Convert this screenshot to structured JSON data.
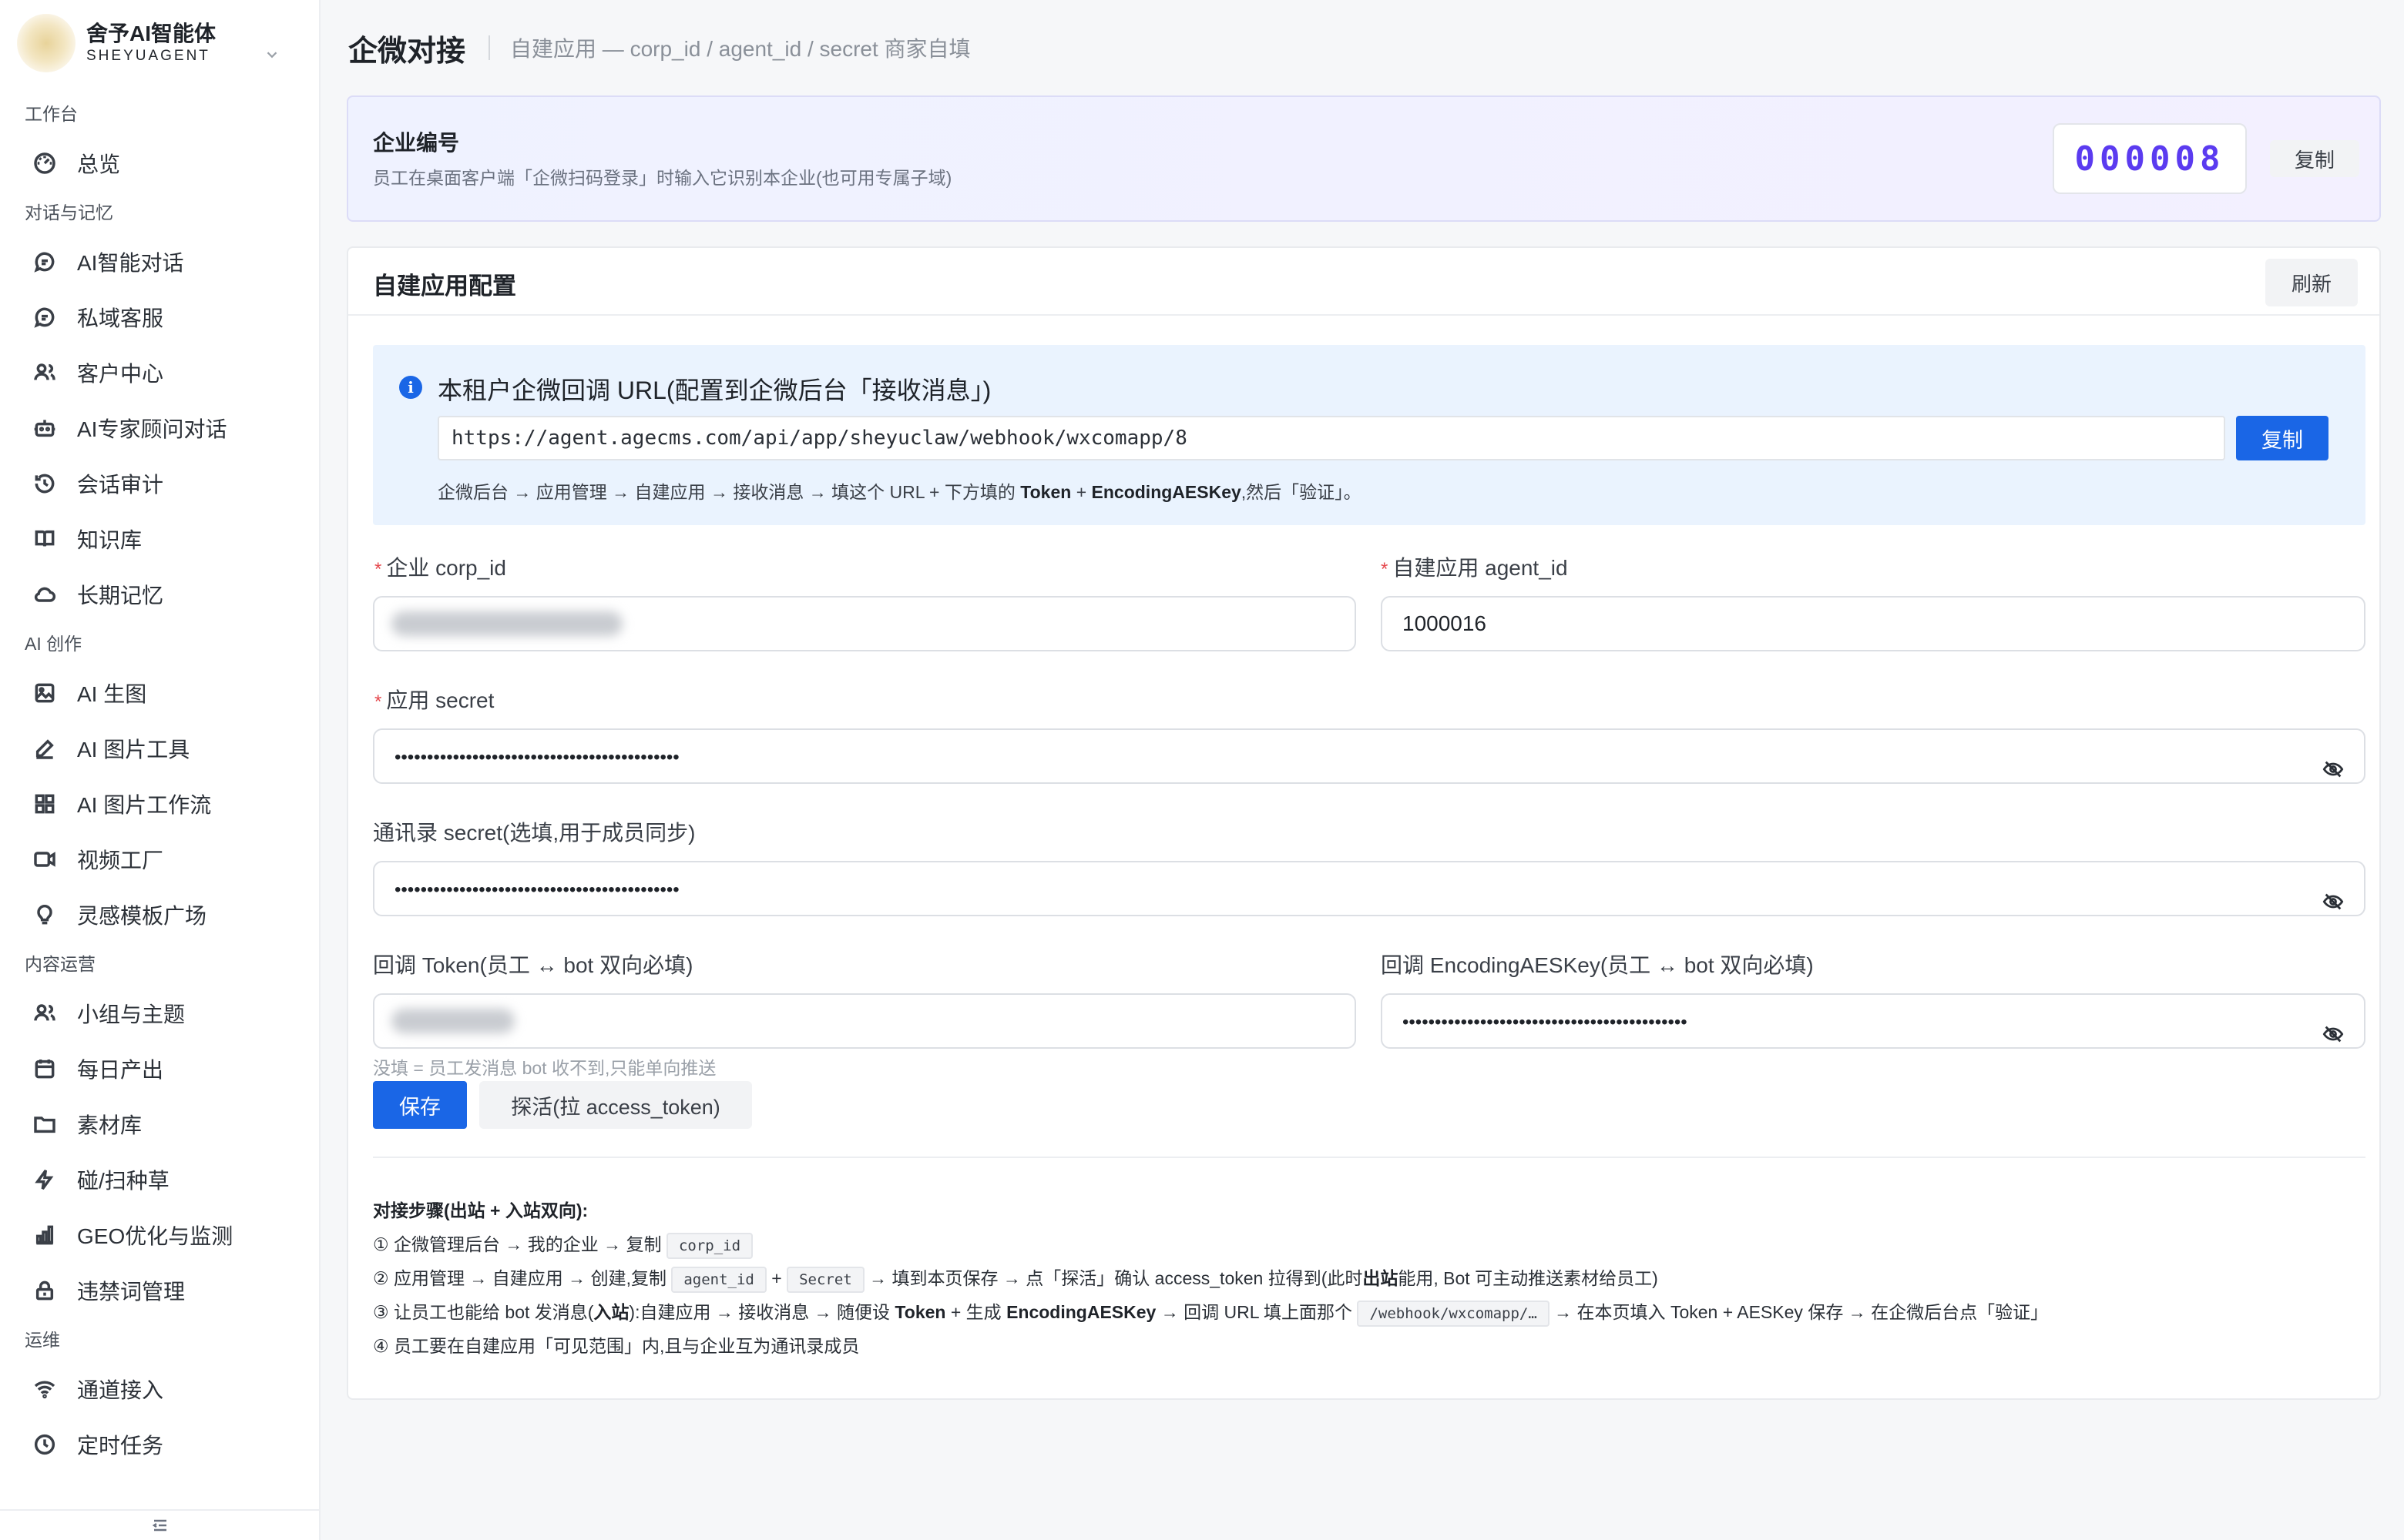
{
  "brand": {
    "name": "舍予AI智能体",
    "sub": "SHEYUAGENT"
  },
  "nav": {
    "sections": [
      {
        "title": "工作台",
        "items": [
          {
            "label": "总览",
            "icon": "dashboard-icon"
          }
        ]
      },
      {
        "title": "对话与记忆",
        "items": [
          {
            "label": "AI智能对话",
            "icon": "chat-icon"
          },
          {
            "label": "私域客服",
            "icon": "chat-icon"
          },
          {
            "label": "客户中心",
            "icon": "users-icon"
          },
          {
            "label": "AI专家顾问对话",
            "icon": "robot-icon"
          },
          {
            "label": "会话审计",
            "icon": "history-icon"
          },
          {
            "label": "知识库",
            "icon": "book-icon"
          },
          {
            "label": "长期记忆",
            "icon": "cloud-icon"
          }
        ]
      },
      {
        "title": "AI 创作",
        "items": [
          {
            "label": "AI 生图",
            "icon": "image-icon"
          },
          {
            "label": "AI 图片工具",
            "icon": "edit-icon"
          },
          {
            "label": "AI 图片工作流",
            "icon": "grid-icon"
          },
          {
            "label": "视频工厂",
            "icon": "video-icon"
          },
          {
            "label": "灵感模板广场",
            "icon": "bulb-icon"
          }
        ]
      },
      {
        "title": "内容运营",
        "items": [
          {
            "label": "小组与主题",
            "icon": "users-icon"
          },
          {
            "label": "每日产出",
            "icon": "calendar-icon"
          },
          {
            "label": "素材库",
            "icon": "folder-icon"
          },
          {
            "label": "碰/扫种草",
            "icon": "bolt-icon"
          },
          {
            "label": "GEO优化与监测",
            "icon": "bar-chart-icon"
          },
          {
            "label": "违禁词管理",
            "icon": "lock-icon"
          }
        ]
      },
      {
        "title": "运维",
        "items": [
          {
            "label": "通道接入",
            "icon": "wifi-icon"
          },
          {
            "label": "定时任务",
            "icon": "clock-icon"
          }
        ]
      }
    ]
  },
  "header": {
    "title": "企微对接",
    "breadcrumb": "自建应用 — corp_id / agent_id / secret 商家自填"
  },
  "company": {
    "title": "企业编号",
    "desc": "员工在桌面客户端「企微扫码登录」时输入它识别本企业(也可用专属子域)",
    "code": "000008",
    "copy_label": "复制"
  },
  "config": {
    "title": "自建应用配置",
    "refresh_label": "刷新",
    "callback": {
      "title": "本租户企微回调 URL(配置到企微后台「接收消息」)",
      "url": "https://agent.agecms.com/api/app/sheyuclaw/webhook/wxcomapp/8",
      "copy_label": "复制",
      "hint_pre": "企微后台 → 应用管理 → 自建应用 → 接收消息 → 填这个 URL + 下方填的 ",
      "hint_token": "Token",
      "hint_plus": " + ",
      "hint_aes": "EncodingAESKey",
      "hint_post": ",然后「验证」。"
    },
    "fields": {
      "corp_id_label": "企业 corp_id",
      "agent_id_label": "自建应用 agent_id",
      "agent_id_value": "1000016",
      "secret_label": "应用 secret",
      "secret_value": "••••••••••••••••••••••••••••••••••••••••••••",
      "contacts_secret_label": "通讯录 secret(选填,用于成员同步)",
      "contacts_secret_value": "••••••••••••••••••••••••••••••••••••••••••••",
      "token_label": "回调 Token(员工 ↔ bot 双向必填)",
      "aes_label": "回调 EncodingAESKey(员工 ↔ bot 双向必填)",
      "aes_value": "••••••••••••••••••••••••••••••••••••••••••••",
      "token_hint": "没填 = 员工发消息 bot 收不到,只能单向推送"
    },
    "actions": {
      "save_label": "保存",
      "probe_label": "探活(拉 access_token)"
    },
    "steps": {
      "title": "对接步骤(出站 + 入站双向):",
      "s1_pre": "① 企微管理后台 → 我的企业 → 复制",
      "s1_code": "corp_id",
      "s2_pre": "② 应用管理 → 自建应用 → 创建,复制",
      "s2_code1": "agent_id",
      "s2_plus": "+",
      "s2_code2": "Secret",
      "s2_mid": "→ 填到本页保存 → 点「探活」确认 access_token 拉得到(此时",
      "s2_bold": "出站",
      "s2_post": "能用, Bot 可主动推送素材给员工)",
      "s3_pre": "③ 让员工也能给 bot 发消息(",
      "s3_bold1": "入站",
      "s3_mid1": "):自建应用 → 接收消息 → 随便设 ",
      "s3_bold2": "Token",
      "s3_mid2": " + 生成 ",
      "s3_bold3": "EncodingAESKey",
      "s3_mid3": " → 回调 URL 填上面那个",
      "s3_code": "/webhook/wxcomapp/…",
      "s3_post": "→ 在本页填入 Token + AESKey 保存 → 在企微后台点「验证」",
      "s4": "④ 员工要在自建应用「可见范围」内,且与企业互为通讯录成员"
    }
  }
}
